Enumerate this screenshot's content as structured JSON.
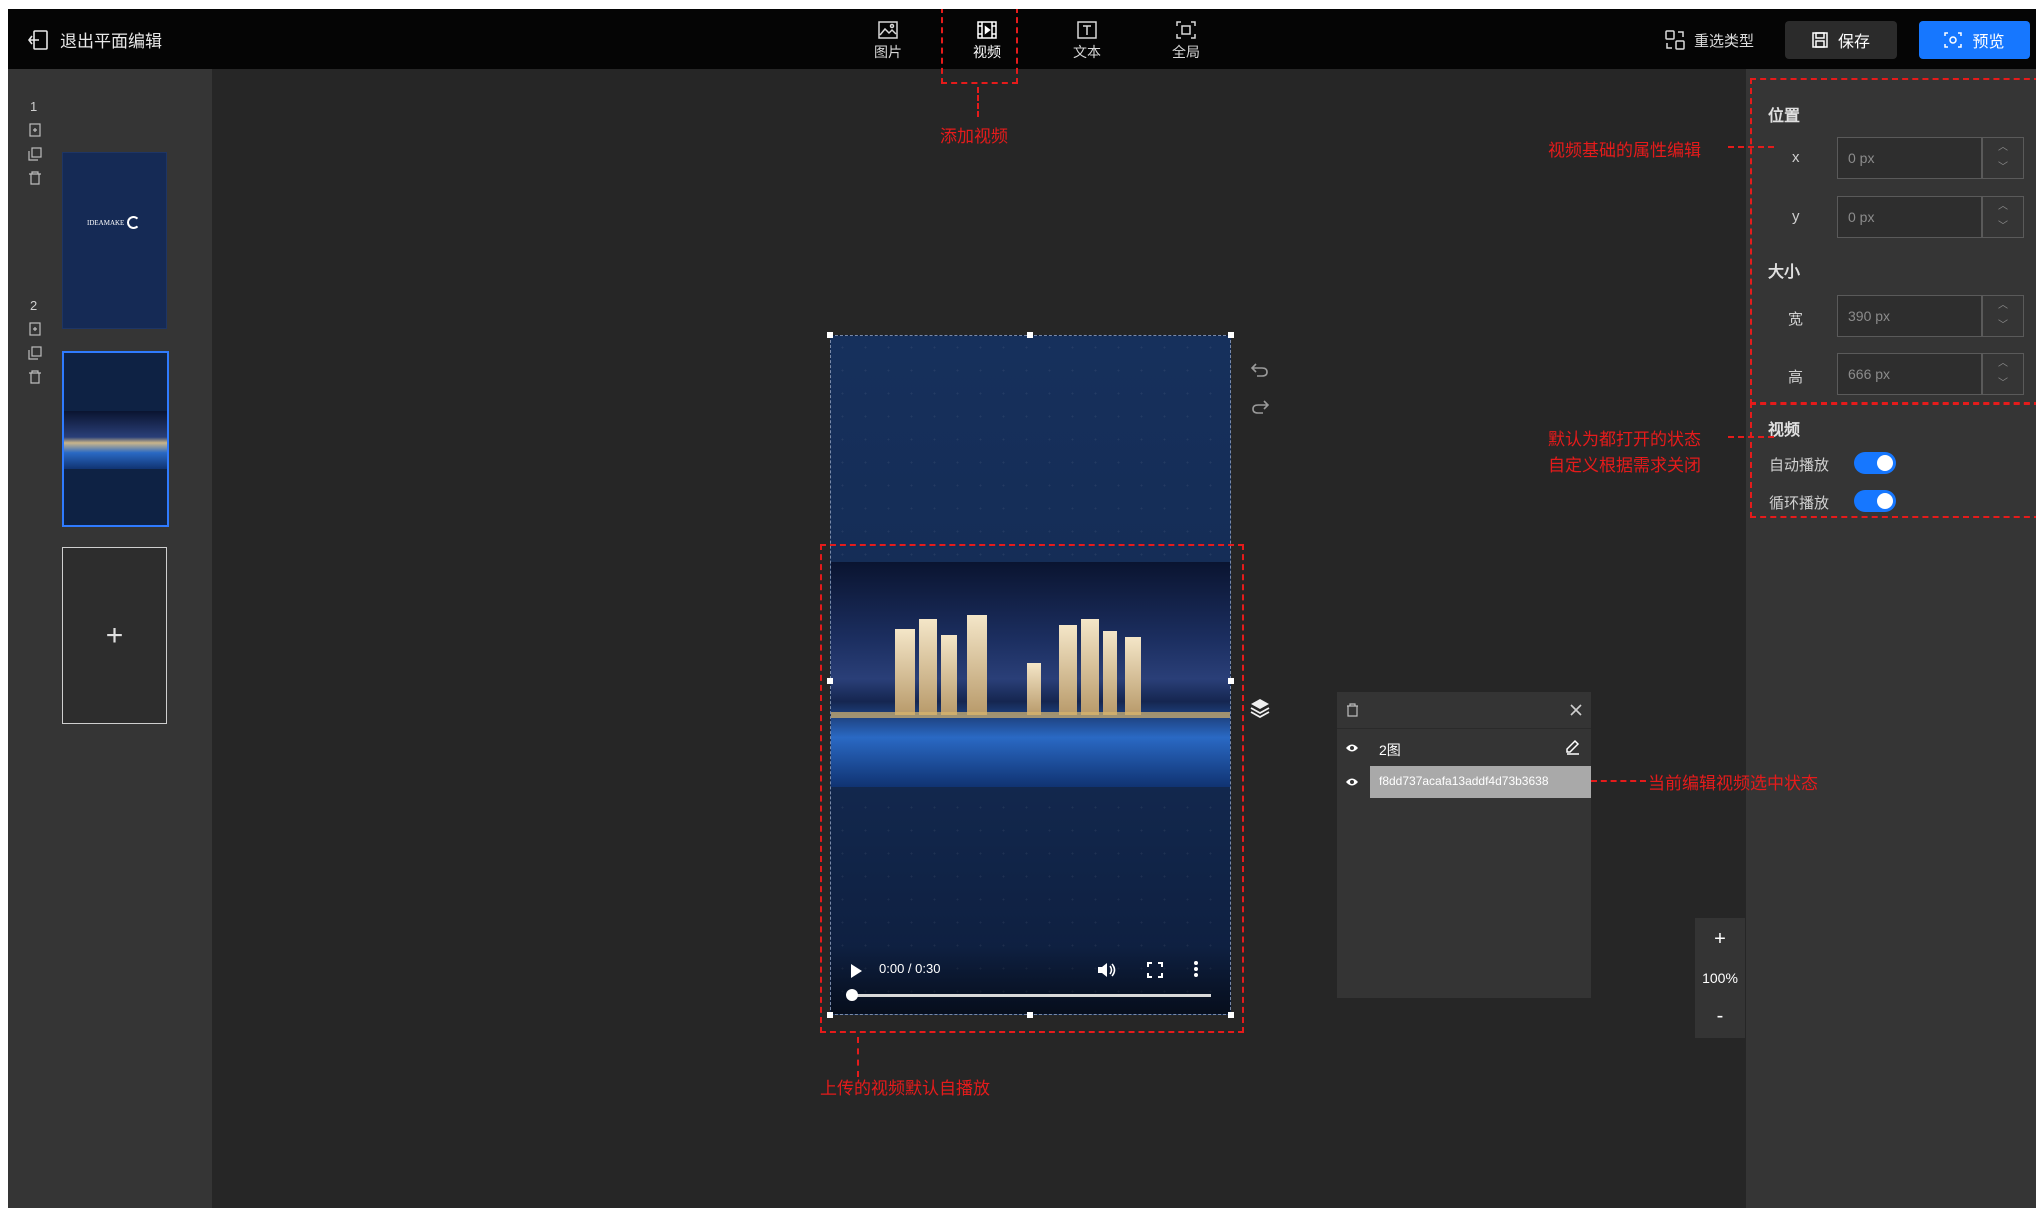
{
  "topbar": {
    "exit_label": "退出平面编辑",
    "tools": [
      {
        "label": "图片",
        "icon": "image-icon"
      },
      {
        "label": "视频",
        "icon": "video-icon"
      },
      {
        "label": "文本",
        "icon": "text-icon"
      },
      {
        "label": "全局",
        "icon": "fullscreen-icon"
      }
    ],
    "reselect_label": "重选类型",
    "save_label": "保存",
    "preview_label": "预览"
  },
  "pages": {
    "items": [
      {
        "number": "1",
        "thumb_text": "IDEAMAKE"
      },
      {
        "number": "2"
      }
    ],
    "add_label": "+"
  },
  "video": {
    "time": "0:00 / 0:30",
    "progress": 0
  },
  "properties": {
    "position_title": "位置",
    "x_label": "x",
    "x_value": "0 px",
    "y_label": "y",
    "y_value": "0 px",
    "size_title": "大小",
    "width_label": "宽",
    "width_value": "390 px",
    "height_label": "高",
    "height_value": "666 px",
    "video_title": "视频",
    "autoplay_label": "自动播放",
    "autoplay_on": true,
    "loop_label": "循环播放",
    "loop_on": true
  },
  "layers": {
    "items": [
      {
        "name": "2图",
        "selected": false
      },
      {
        "name": "f8dd737acafa13addf4d73b3638",
        "selected": true
      }
    ]
  },
  "zoom": {
    "plus": "+",
    "level": "100%",
    "minus": "-"
  },
  "annotations": {
    "add_video": "添加视频",
    "base_props": "视频基础的属性编辑",
    "default_on_line1": "默认为都打开的状态",
    "default_on_line2": "自定义根据需求关闭",
    "selected_state": "当前编辑视频选中状态",
    "autoplay_default": "上传的视频默认自播放"
  },
  "colors": {
    "accent": "#1677ff",
    "annotation": "#e51b1b",
    "topbar": "#050505",
    "canvas": "#262626",
    "panel": "#353535"
  }
}
